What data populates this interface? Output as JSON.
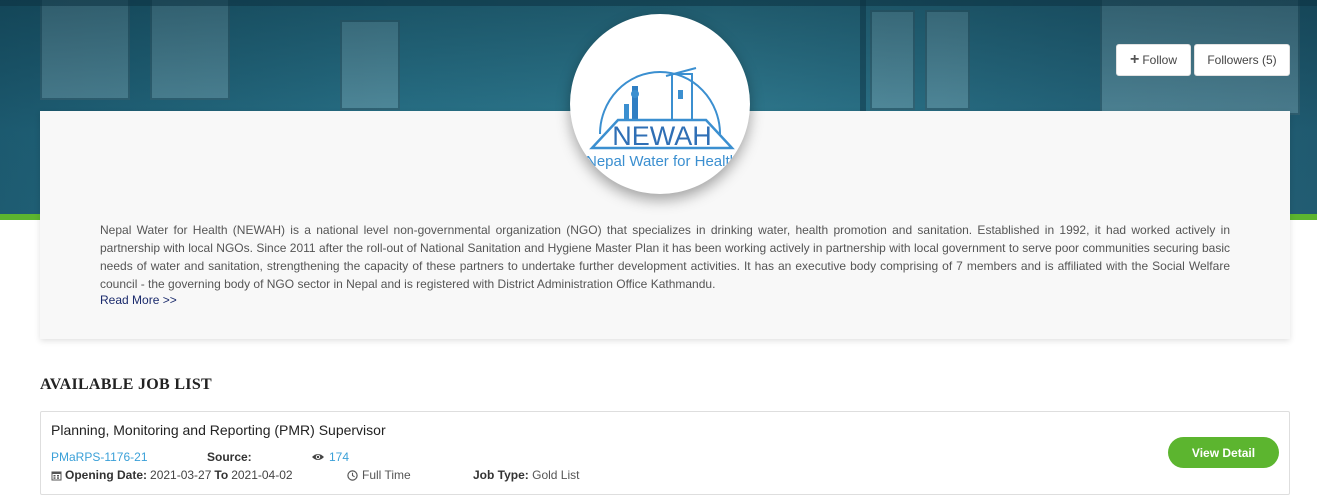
{
  "header": {
    "follow_label": "Follow",
    "followers_label": "Followers (5)",
    "logo": {
      "text": "NEWAH",
      "subtext": "Nepal Water for Health"
    }
  },
  "profile": {
    "description": "Nepal Water for Health (NEWAH) is a national level non-governmental organization (NGO) that specializes in drinking water, health promotion and sanitation. Established in 1992, it had worked actively in partnership with local NGOs. Since 2011 after the roll-out of National Sanitation and Hygiene Master Plan it has been working actively in partnership with local government to serve poor communities securing basic needs of water and sanitation, strengthening the capacity of these partners to undertake further development activities. It has an executive body comprising of 7 members and is affiliated with the Social Welfare council - the governing body of NGO sector in Nepal and is registered with District Administration Office Kathmandu.",
    "read_more": "Read More >>"
  },
  "jobs_section": {
    "title": "AVAILABLE JOB LIST",
    "jobs": [
      {
        "title": "Planning, Monitoring and Reporting (PMR) Supervisor",
        "code": "PMaRPS-1176-21",
        "source_label": "Source:",
        "views": "174",
        "opening_label": "Opening Date:",
        "opening_date": "2021-03-27",
        "to_label": "To",
        "closing_date": "2021-04-02",
        "job_time": "Full Time",
        "job_type_label": "Job Type:",
        "job_type": "Gold List",
        "view_detail": "View Detail"
      }
    ]
  },
  "colors": {
    "accent_green": "#5cb52f",
    "link_blue": "#3aa0d8",
    "logo_blue": "#3b8fd0"
  }
}
